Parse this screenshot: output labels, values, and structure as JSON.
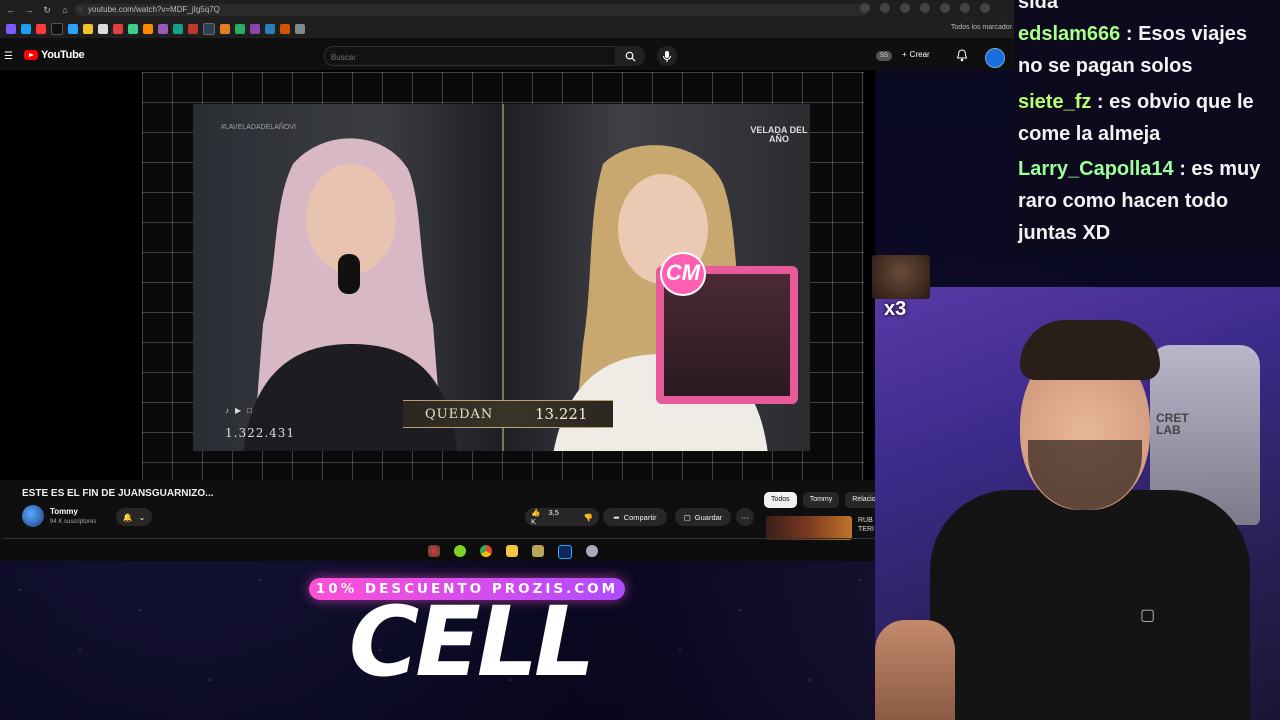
{
  "browser": {
    "url": "youtube.com/watch?v=MDF_jIg5q7Q",
    "bookmarks_all": "Todos los marcador"
  },
  "youtube": {
    "logo": "YouTube",
    "search_placeholder": "Buscar",
    "create_label": "Crear",
    "ss_badge": "SS"
  },
  "video": {
    "hashtag": "#LAVELADADELAÑOVI",
    "brand": "VELADA\nDEL AÑO",
    "quedan_label": "QUEDAN",
    "quedan_value": "13.221",
    "viewer_count": "1.322.431",
    "cm_logo": "CM"
  },
  "details": {
    "title": "ESTE ES EL FIN DE JUANSGUARNIZO...",
    "channel": "Tommy",
    "subscribers": "94 K suscriptores",
    "likes": "3,5 K",
    "share": "Compartir",
    "save": "Guardar",
    "chips": [
      "Todos",
      "Tommy",
      "Relacio"
    ],
    "rec_text_1": "RUB",
    "rec_text_2": "TERI"
  },
  "overlay": {
    "promo": "10% DESCUENTO PROZIS.COM",
    "cell": "CELL",
    "emote_multiplier": "x3",
    "chair_brand_1": "CRET",
    "chair_brand_2": "LAB"
  },
  "chat": {
    "top_cut": "sida",
    "messages": [
      {
        "user": "edslam666",
        "text": " : Esos viajes no se pagan solos"
      },
      {
        "user": "siete_fz",
        "text": " : es obvio que le come la almeja"
      },
      {
        "user": "Larry_Capolla14",
        "text": " : es muy raro como hacen todo juntas XD"
      }
    ]
  },
  "colors": {
    "youtube_red": "#ff0000",
    "promo_pink": "#ff4fd8",
    "chat_user": "#a8ff8a"
  }
}
